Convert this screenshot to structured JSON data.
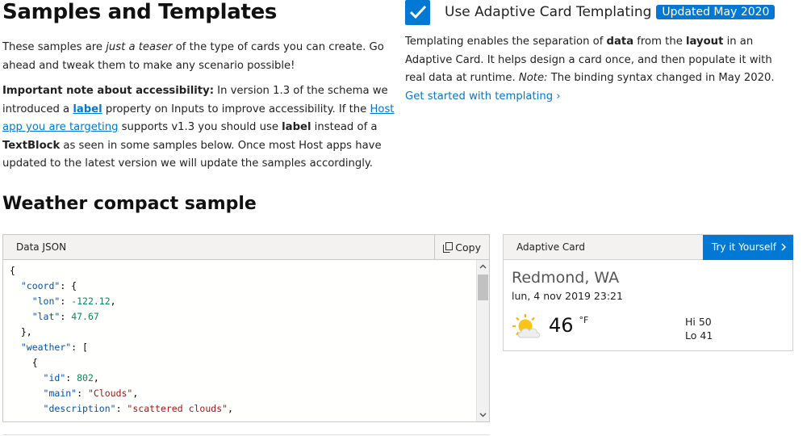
{
  "page": {
    "title": "Samples and Templates",
    "intro_p1_a": "These samples are ",
    "intro_p1_em": "just a teaser",
    "intro_p1_b": " of the type of cards you can create. Go ahead and tweak them to make any scenario possible!",
    "note_strong": "Important note about accessibility:",
    "note_a": " In version 1.3 of the schema we introduced a ",
    "note_label_link": "label",
    "note_b": " property on Inputs to improve accessibility. If the ",
    "note_host_link": "Host app you are targeting",
    "note_c": " supports v1.3 you should use ",
    "note_label_bold": "label",
    "note_d": " instead of a ",
    "note_textblock": "TextBlock",
    "note_e": " as seen in some samples below. Once most Host apps have updated to the latest version we will update the samples accordingly."
  },
  "templating": {
    "checkbox_checked": true,
    "label": "Use Adaptive Card Templating",
    "badge": "Updated May 2020",
    "desc_a": "Templating enables the separation of ",
    "desc_data": "data",
    "desc_b": " from the ",
    "desc_layout": "layout",
    "desc_c": " in an Adaptive Card. It helps design a card once, and then populate it with real data at runtime. ",
    "desc_note": "Note:",
    "desc_d": " The binding syntax changed in May 2020. ",
    "link": "Get started with templating ›"
  },
  "sample": {
    "title": "Weather compact sample",
    "json_panel_title": "Data JSON",
    "copy_label": "Copy",
    "json_lines": [
      [
        {
          "t": "p",
          "v": "{"
        }
      ],
      [
        {
          "t": "p",
          "v": "  "
        },
        {
          "t": "k",
          "v": "\"coord\""
        },
        {
          "t": "p",
          "v": ": {"
        }
      ],
      [
        {
          "t": "p",
          "v": "    "
        },
        {
          "t": "k",
          "v": "\"lon\""
        },
        {
          "t": "p",
          "v": ": "
        },
        {
          "t": "n",
          "v": "-122.12"
        },
        {
          "t": "p",
          "v": ","
        }
      ],
      [
        {
          "t": "p",
          "v": "    "
        },
        {
          "t": "k",
          "v": "\"lat\""
        },
        {
          "t": "p",
          "v": ": "
        },
        {
          "t": "n",
          "v": "47.67"
        }
      ],
      [
        {
          "t": "p",
          "v": "  },"
        }
      ],
      [
        {
          "t": "p",
          "v": "  "
        },
        {
          "t": "k",
          "v": "\"weather\""
        },
        {
          "t": "p",
          "v": ": ["
        }
      ],
      [
        {
          "t": "p",
          "v": "    {"
        }
      ],
      [
        {
          "t": "p",
          "v": "      "
        },
        {
          "t": "k",
          "v": "\"id\""
        },
        {
          "t": "p",
          "v": ": "
        },
        {
          "t": "n",
          "v": "802"
        },
        {
          "t": "p",
          "v": ","
        }
      ],
      [
        {
          "t": "p",
          "v": "      "
        },
        {
          "t": "k",
          "v": "\"main\""
        },
        {
          "t": "p",
          "v": ": "
        },
        {
          "t": "s",
          "v": "\"Clouds\""
        },
        {
          "t": "p",
          "v": ","
        }
      ],
      [
        {
          "t": "p",
          "v": "      "
        },
        {
          "t": "k",
          "v": "\"description\""
        },
        {
          "t": "p",
          "v": ": "
        },
        {
          "t": "s",
          "v": "\"scattered clouds\""
        },
        {
          "t": "p",
          "v": ","
        }
      ]
    ],
    "card_panel_title": "Adaptive Card",
    "try_label": "Try it Yourself",
    "card": {
      "city": "Redmond, WA",
      "datetime": "lun, 4 nov 2019 23:21",
      "weather_icon": "partly-cloudy-sun-icon",
      "temp": "46",
      "unit": "°F",
      "hi": "Hi 50",
      "lo": "Lo 41"
    }
  },
  "colors": {
    "accent": "#0078d4",
    "json_key": "#0451a5",
    "json_number": "#098658",
    "json_string": "#a31515"
  }
}
